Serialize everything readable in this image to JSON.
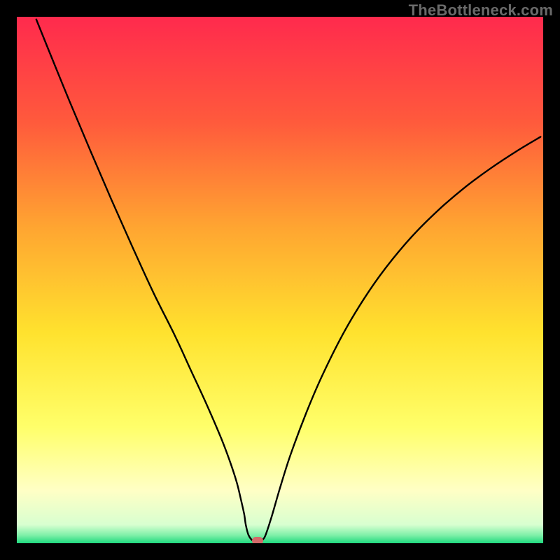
{
  "watermark": "TheBottleneck.com",
  "chart_data": {
    "type": "line",
    "title": "",
    "xlabel": "",
    "ylabel": "",
    "xlim": [
      0,
      100
    ],
    "ylim": [
      0,
      100
    ],
    "gradient_stops": [
      {
        "offset": 0,
        "color": "#ff2a4d"
      },
      {
        "offset": 0.2,
        "color": "#ff5a3c"
      },
      {
        "offset": 0.4,
        "color": "#ffa531"
      },
      {
        "offset": 0.6,
        "color": "#ffe22e"
      },
      {
        "offset": 0.78,
        "color": "#ffff6a"
      },
      {
        "offset": 0.9,
        "color": "#ffffc5"
      },
      {
        "offset": 0.965,
        "color": "#d8ffd0"
      },
      {
        "offset": 0.985,
        "color": "#7ef0a8"
      },
      {
        "offset": 1.0,
        "color": "#1fd97e"
      }
    ],
    "series": [
      {
        "name": "curve",
        "x": [
          3.7,
          6,
          10,
          14,
          18,
          22,
          26,
          30,
          33,
          36,
          38.8,
          40.5,
          41.8,
          42.6,
          43.2,
          43.5,
          44.0,
          44.8,
          45.6,
          46.2,
          46.6,
          47.2,
          48.4,
          50,
          52,
          55,
          58,
          62,
          66,
          70,
          75,
          80,
          85,
          90,
          95,
          99.5
        ],
        "y": [
          99.5,
          93.8,
          84.0,
          74.5,
          65.2,
          56.2,
          47.5,
          39.5,
          33.0,
          26.5,
          20.0,
          15.5,
          11.5,
          8.2,
          5.5,
          3.5,
          1.6,
          0.5,
          0.42,
          0.42,
          0.6,
          1.4,
          5.0,
          10.5,
          16.8,
          24.8,
          31.8,
          39.8,
          46.5,
          52.2,
          58.2,
          63.2,
          67.5,
          71.2,
          74.5,
          77.2
        ]
      }
    ],
    "marker": {
      "x": 45.8,
      "y": 0.42,
      "color": "#d46a6a"
    }
  }
}
